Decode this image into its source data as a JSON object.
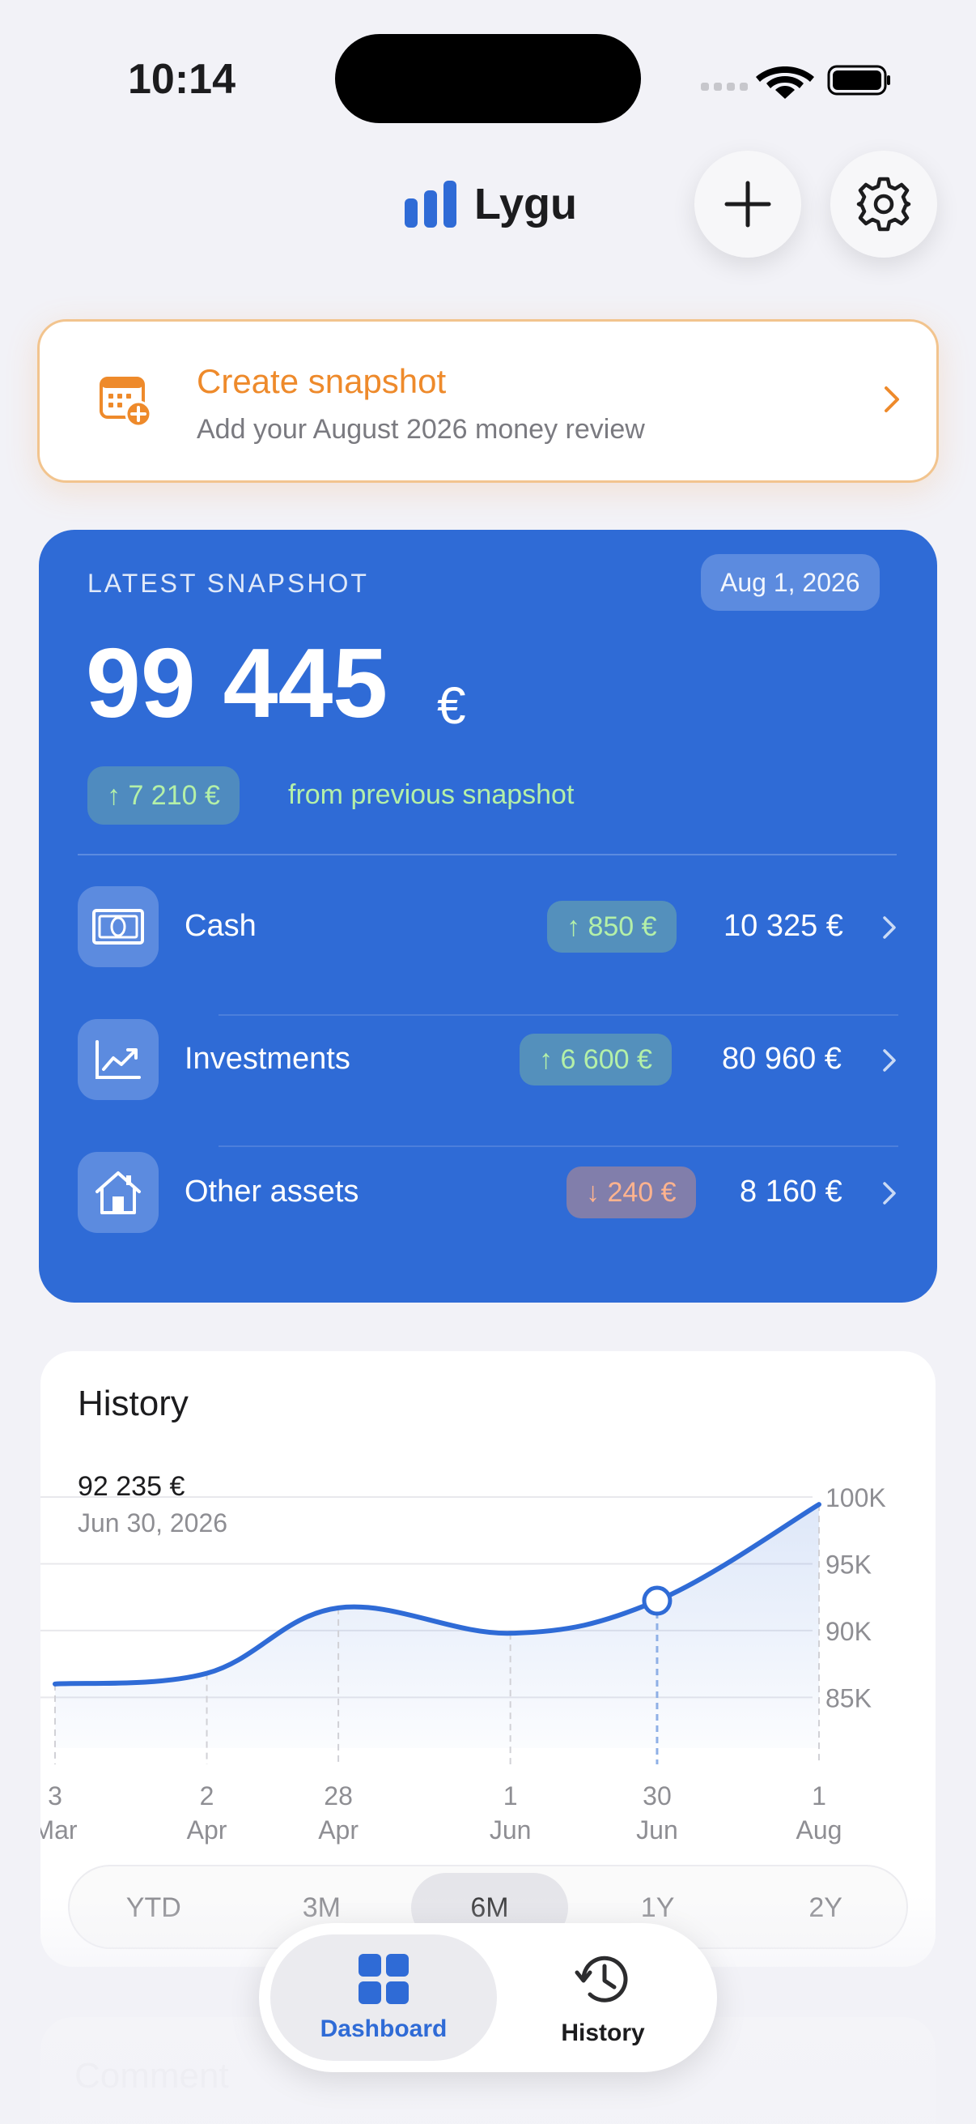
{
  "status_bar": {
    "time": "10:14"
  },
  "header": {
    "app_name": "Lygu",
    "icons": [
      "bar-chart-icon",
      "plus-icon",
      "gear-icon"
    ]
  },
  "banner": {
    "title": "Create snapshot",
    "subtitle": "Add your August 2026 money review",
    "icon": "calendar-add-icon"
  },
  "latest": {
    "label": "LATEST SNAPSHOT",
    "date": "Aug 1, 2026",
    "total": "99 445",
    "currency": "€",
    "delta": "↑ 7 210 €",
    "delta_text": "from previous snapshot",
    "assets": [
      {
        "name": "Cash",
        "change": "↑ 850 €",
        "value": "10 325 €",
        "trend": "up",
        "icon": "banknote-icon"
      },
      {
        "name": "Investments",
        "change": "↑ 6 600 €",
        "value": "80 960 €",
        "trend": "up",
        "icon": "chart-line-icon"
      },
      {
        "name": "Other assets",
        "change": "↓ 240 €",
        "value": "8 160 €",
        "trend": "down",
        "icon": "house-icon"
      }
    ]
  },
  "history": {
    "title": "History",
    "selected_value": "92 235 €",
    "selected_date": "Jun 30, 2026",
    "ranges": [
      "YTD",
      "3M",
      "6M",
      "1Y",
      "2Y"
    ],
    "active_range": "6M"
  },
  "chart_data": {
    "type": "line",
    "x_labels": [
      [
        "3",
        "Mar"
      ],
      [
        "2",
        "Apr"
      ],
      [
        "28",
        "Apr"
      ],
      [
        "1",
        "Jun"
      ],
      [
        "30",
        "Jun"
      ],
      [
        "1",
        "Aug"
      ]
    ],
    "x": [
      "2026-03-03",
      "2026-04-02",
      "2026-04-28",
      "2026-06-01",
      "2026-06-30",
      "2026-08-01"
    ],
    "values": [
      86000,
      86800,
      91700,
      89800,
      92235,
      99445
    ],
    "y_ticks": [
      "100K",
      "95K",
      "90K",
      "85K"
    ],
    "ylim": [
      83200,
      100000
    ],
    "highlighted_index": 4,
    "color": "#2f6bd6"
  },
  "comment": {
    "label": "Comment"
  },
  "tabbar": {
    "tabs": [
      {
        "label": "Dashboard",
        "active": true,
        "icon": "grid-icon"
      },
      {
        "label": "History",
        "active": false,
        "icon": "clock-history-icon"
      }
    ]
  },
  "colors": {
    "accent": "#2f6bd6",
    "orange": "#ee8a2b",
    "positive": "#b4f0a8",
    "negative": "#ffb38e"
  }
}
